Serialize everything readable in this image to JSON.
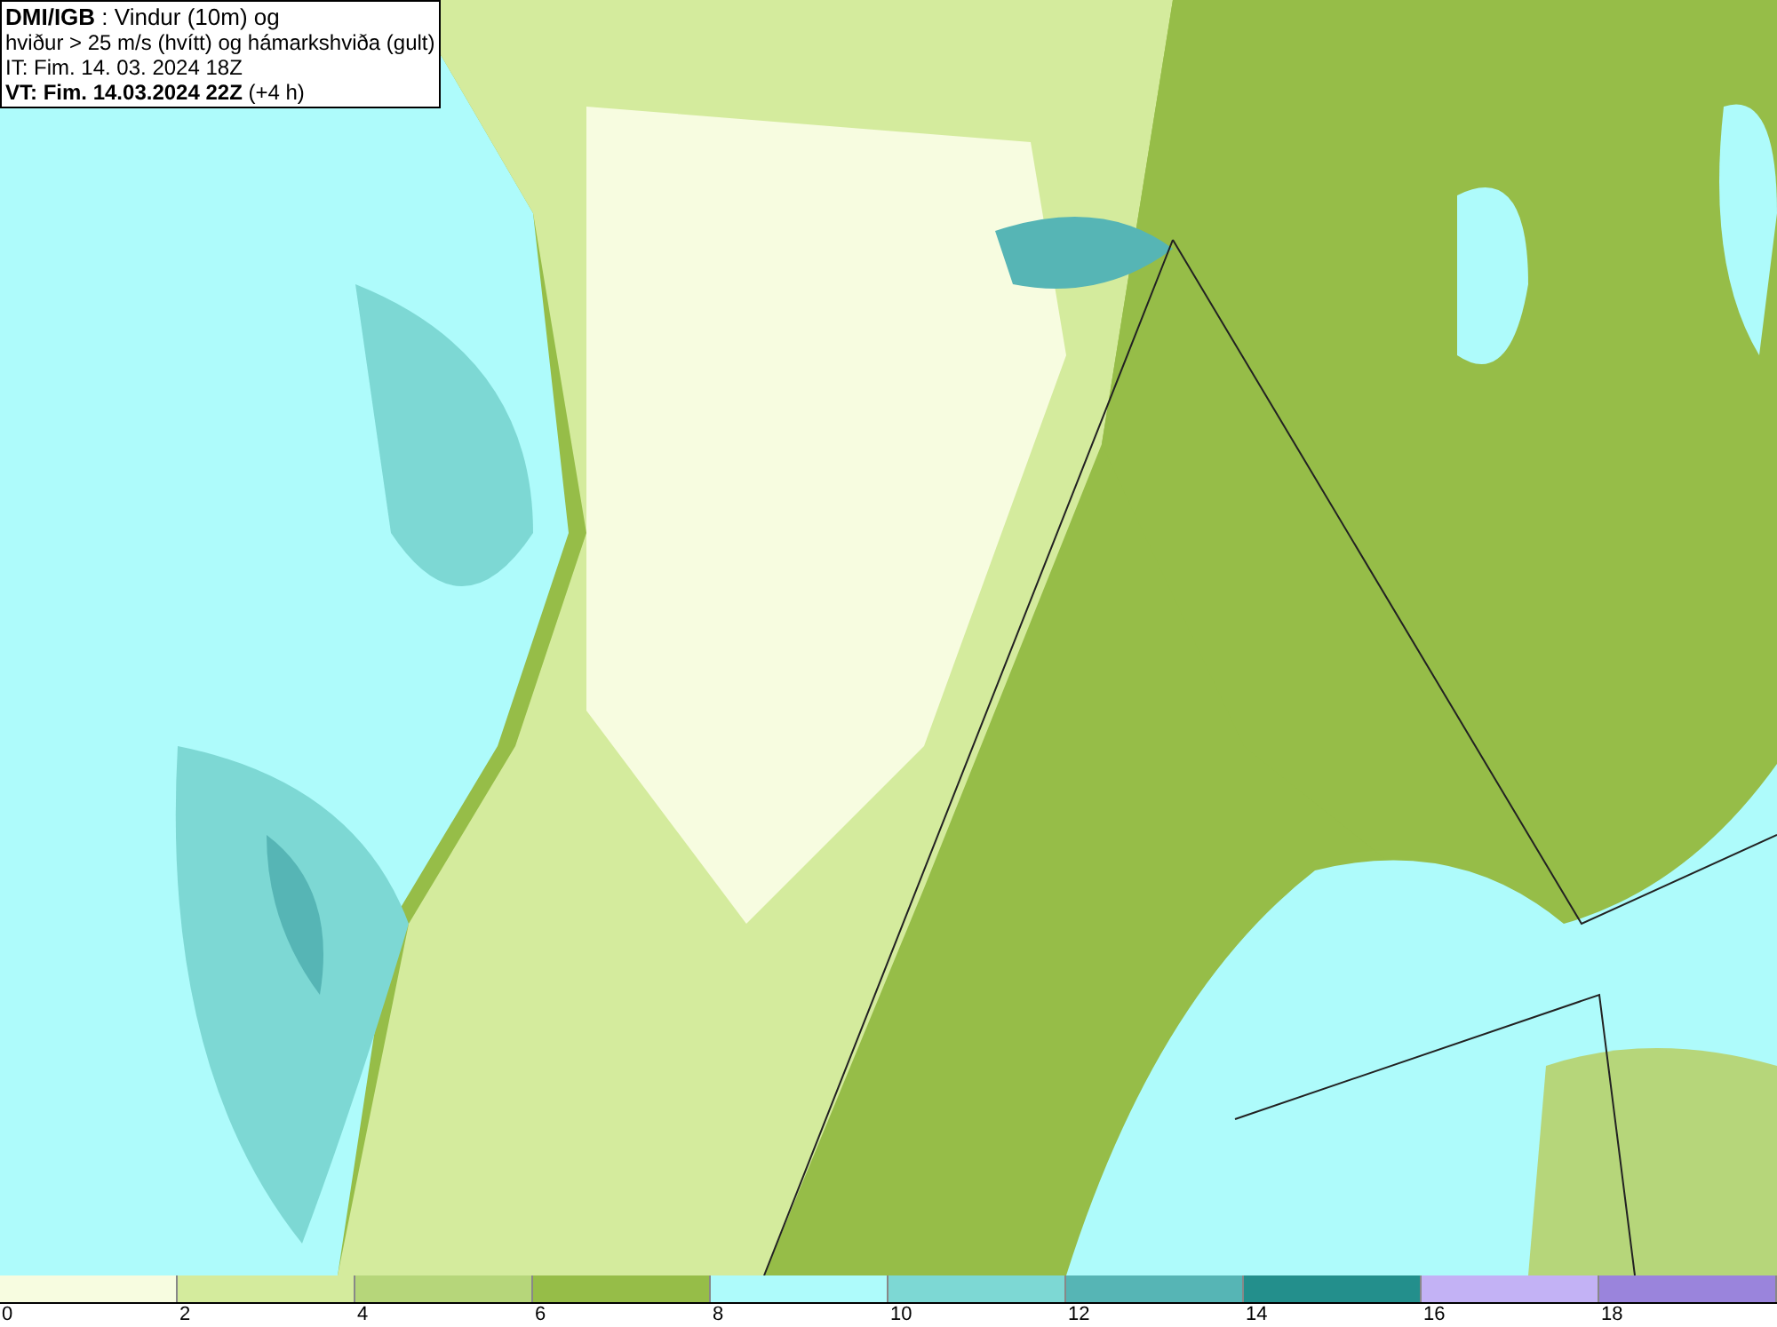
{
  "title_box": {
    "lines": [
      "**DMI/IGB** : Vindur (10m) og",
      "hviður > 25 m/s (hvítt) og hámarkshviða (gult)",
      "IT: Fim. 14. 03. 2024 18Z",
      "**VT: Fim. 14.03.2024 22Z** (+4 h)"
    ]
  },
  "legend": {
    "bins": [
      {
        "color": "#f7fce0",
        "tick": "0"
      },
      {
        "color": "#d4eb9d",
        "tick": "2"
      },
      {
        "color": "#b6d67a",
        "tick": "4"
      },
      {
        "color": "#96bd48",
        "tick": "6"
      },
      {
        "color": "#aefbfb",
        "tick": "8"
      },
      {
        "color": "#7dd8d4",
        "tick": "10"
      },
      {
        "color": "#56b5b5",
        "tick": "12"
      },
      {
        "color": "#238f8c",
        "tick": "14"
      },
      {
        "color": "#c3b2f5",
        "tick": "16"
      },
      {
        "color": "#9a84dc",
        "tick": "18"
      }
    ]
  }
}
